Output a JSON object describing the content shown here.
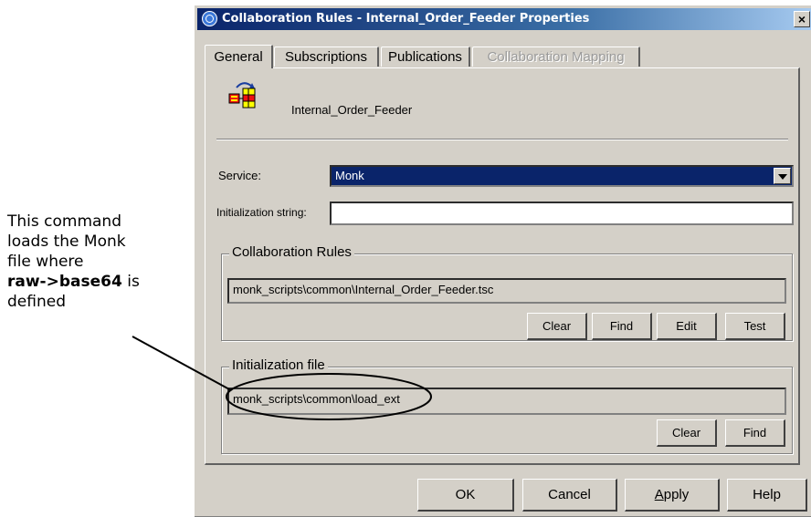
{
  "note": {
    "line1": "This command",
    "line2": "loads the Monk",
    "line3": "file where",
    "line4_bold": "raw->base64",
    "line4_rest": " is",
    "line5": "defined"
  },
  "dialog": {
    "title": "Collaboration Rules - Internal_Order_Feeder Properties",
    "close": "×"
  },
  "tabs": [
    {
      "label": "General",
      "state": "active"
    },
    {
      "label": "Subscriptions",
      "state": "normal"
    },
    {
      "label": "Publications",
      "state": "normal"
    },
    {
      "label": "Collaboration Mapping",
      "state": "disabled"
    }
  ],
  "general": {
    "component_name": "Internal_Order_Feeder",
    "service_label": "Service:",
    "service_value": "Monk",
    "init_string_label": "Initialization string:",
    "init_string_value": "",
    "collab_rules": {
      "legend": "Collaboration Rules",
      "path": "monk_scripts\\common\\Internal_Order_Feeder.tsc",
      "buttons": {
        "clear": "Clear",
        "find": "Find",
        "edit": "Edit",
        "test": "Test"
      }
    },
    "init_file": {
      "legend": "Initialization file",
      "path": "monk_scripts\\common\\load_ext",
      "buttons": {
        "clear": "Clear",
        "find": "Find"
      }
    }
  },
  "footer": {
    "ok": "OK",
    "cancel": "Cancel",
    "apply_prefix": "",
    "apply_mnemonic": "A",
    "apply_rest": "pply",
    "help": "Help"
  }
}
